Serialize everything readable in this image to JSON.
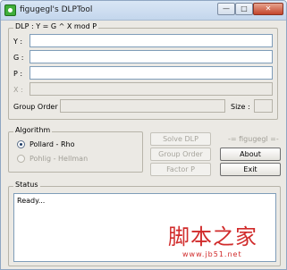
{
  "window": {
    "title": "figugegl's DLPTool"
  },
  "titlebar_buttons": {
    "minimize": "—",
    "maximize": "□",
    "close": "✕"
  },
  "dlp": {
    "legend": "DLP : Y = G ^ X mod P",
    "y_label": "Y :",
    "g_label": "G :",
    "p_label": "P :",
    "x_label": "X :",
    "group_order_label": "Group Order :",
    "size_label": "Size :"
  },
  "algorithm": {
    "legend": "Algorithm",
    "options": [
      "Pollard - Rho",
      "Pohlig - Hellman"
    ],
    "selected": "Pollard - Rho"
  },
  "buttons": {
    "solve": "Solve DLP",
    "group_order": "Group Order",
    "factor": "Factor P",
    "credit": "-= figugegl =-",
    "about": "About",
    "exit": "Exit"
  },
  "status": {
    "legend": "Status",
    "text": "Ready..."
  },
  "watermark": {
    "main": "脚本之家",
    "url": "www.jb51.net"
  }
}
